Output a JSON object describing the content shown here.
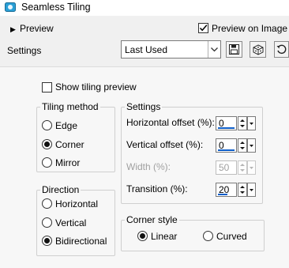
{
  "window": {
    "title": "Seamless Tiling"
  },
  "preview_section": {
    "label": "Preview",
    "preview_on_image_label": "Preview on Image",
    "preview_on_image_checked": true
  },
  "settings_row": {
    "label": "Settings",
    "preset_value": "Last Used"
  },
  "icons": {
    "app": "seamless-tiling-icon",
    "save": "save-icon",
    "randomize": "dice-icon",
    "reset": "reset-icon"
  },
  "show_tiling_preview": {
    "label": "Show tiling preview",
    "checked": false
  },
  "tiling_method": {
    "title": "Tiling method",
    "options": [
      {
        "label": "Edge",
        "selected": false
      },
      {
        "label": "Corner",
        "selected": true
      },
      {
        "label": "Mirror",
        "selected": false
      }
    ]
  },
  "direction": {
    "title": "Direction",
    "options": [
      {
        "label": "Horizontal",
        "selected": false
      },
      {
        "label": "Vertical",
        "selected": false
      },
      {
        "label": "Bidirectional",
        "selected": true
      }
    ]
  },
  "settings_group": {
    "title": "Settings",
    "horizontal_offset": {
      "label": "Horizontal offset (%):",
      "value": "0"
    },
    "vertical_offset": {
      "label": "Vertical offset (%):",
      "value": "0"
    },
    "width": {
      "label": "Width (%):",
      "value": "50",
      "disabled": true
    },
    "transition": {
      "label": "Transition (%):",
      "value": "20"
    }
  },
  "corner_style": {
    "title": "Corner style",
    "options": [
      {
        "label": "Linear",
        "selected": true
      },
      {
        "label": "Curved",
        "selected": false
      }
    ]
  },
  "colors": {
    "accent": "#0f5fc9",
    "panel": "#f7f7f7",
    "window": "#f0f0f0"
  }
}
